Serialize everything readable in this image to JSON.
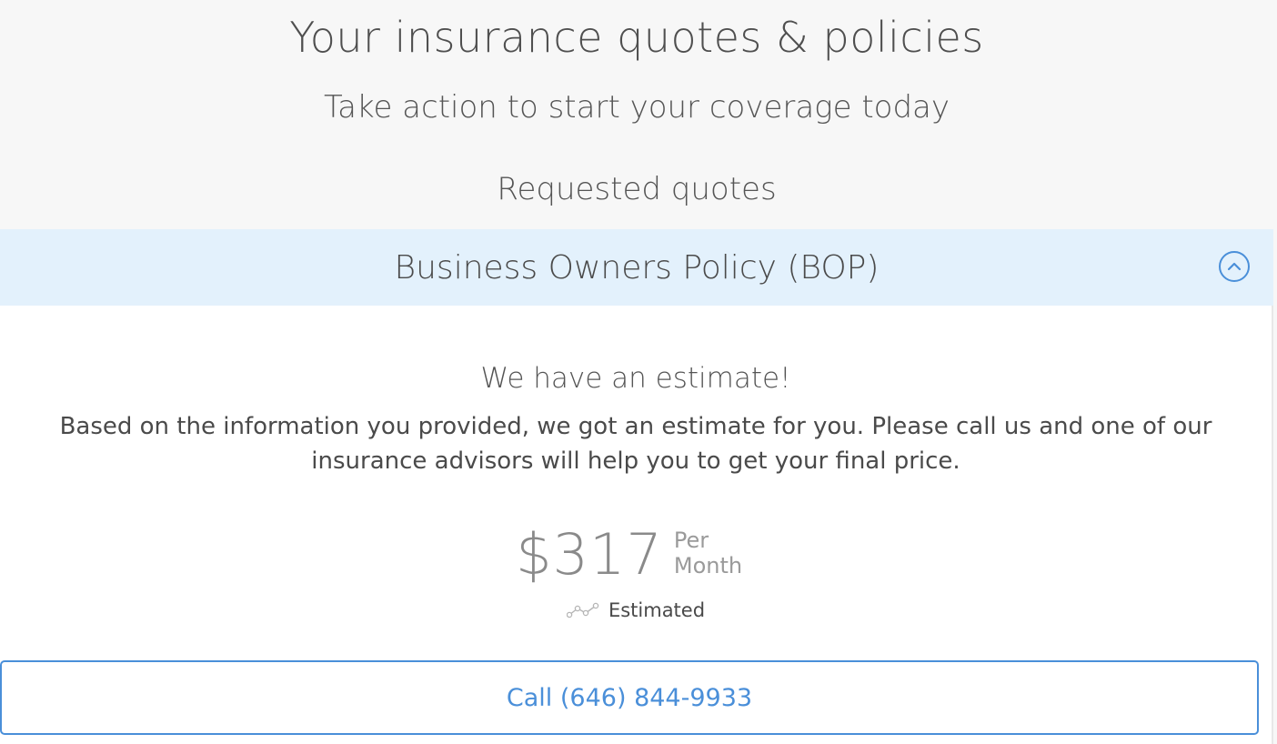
{
  "header": {
    "title": "Your insurance quotes & policies",
    "subtitle": "Take action to start your coverage today",
    "section_title": "Requested quotes"
  },
  "accordion": {
    "title": "Business Owners Policy (BOP)",
    "toggle_icon": "chevron-up-circle-icon",
    "expanded": true
  },
  "estimate": {
    "heading": "We have an estimate!",
    "description": "Based on the information you provided, we got an estimate for you. Please call us and one of our insurance advisors will help you to get your final price.",
    "price": "$317",
    "period_line1": "Per",
    "period_line2": "Month",
    "status_icon": "trend-line-icon",
    "status_label": "Estimated"
  },
  "call_button": {
    "label": "Call (646) 844-9933"
  },
  "colors": {
    "accent": "#4a8fd9",
    "accordion_bg": "#e3f1fc",
    "page_bg": "#f7f7f7"
  }
}
